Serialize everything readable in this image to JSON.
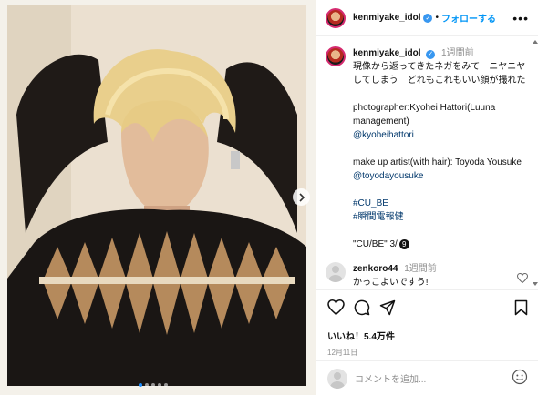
{
  "header": {
    "username": "kenmiyake_idol",
    "separator": "•",
    "follow_label": "フォローする",
    "more_label": "•••"
  },
  "caption": {
    "username": "kenmiyake_idol",
    "time": "1週間前",
    "line1": "現像から返ってきたネガをみて　ニヤニヤしてしまう　どれもこれもいい顔が撮れた",
    "photographer_label": "photographer:Kyohei Hattori(Luuna management)",
    "photographer_handle": "@kyoheihattori",
    "makeup_label": "make up artist(with hair): Toyoda Yousuke",
    "makeup_handle": "@toyodayousuke",
    "tag1": "#CU_BE",
    "tag2": "#瞬間電報健",
    "footer": "\"CU/BE\" 3/",
    "footer_badge": "9"
  },
  "comment": {
    "username": "zenkoro44",
    "time": "1週間前",
    "text": "かっこよいですう!"
  },
  "stats": {
    "likes": "いいね！5.4万件",
    "date": "12月11日"
  },
  "input": {
    "placeholder": "コメントを追加..."
  },
  "icons": [
    "heart-icon",
    "comment-icon",
    "share-icon",
    "bookmark-icon",
    "emoji-icon",
    "chevron-right-icon",
    "more-icon"
  ],
  "colors": {
    "accent": "#0095f6",
    "link": "#00376b",
    "muted": "#8e8e8e"
  },
  "carousel": {
    "slides": 5,
    "current": 1
  }
}
